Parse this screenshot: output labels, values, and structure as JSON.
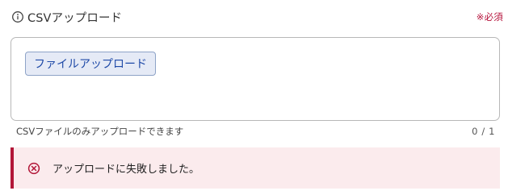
{
  "field": {
    "label": "CSVアップロード",
    "info_icon": "info-icon",
    "required_text": "※必須"
  },
  "upload": {
    "button_label": "ファイルアップロード",
    "helper_text": "CSVファイルのみアップロードできます",
    "counter": "0 / 1"
  },
  "alert": {
    "icon": "x-circle-icon",
    "message": "アップロードに失敗しました。"
  },
  "colors": {
    "required": "#b5123b",
    "button_bg": "#e5eaf6",
    "button_border": "#8ea3c7",
    "button_text": "#1f4aa8",
    "alert_bg": "#fbebed",
    "alert_accent": "#b21638"
  }
}
